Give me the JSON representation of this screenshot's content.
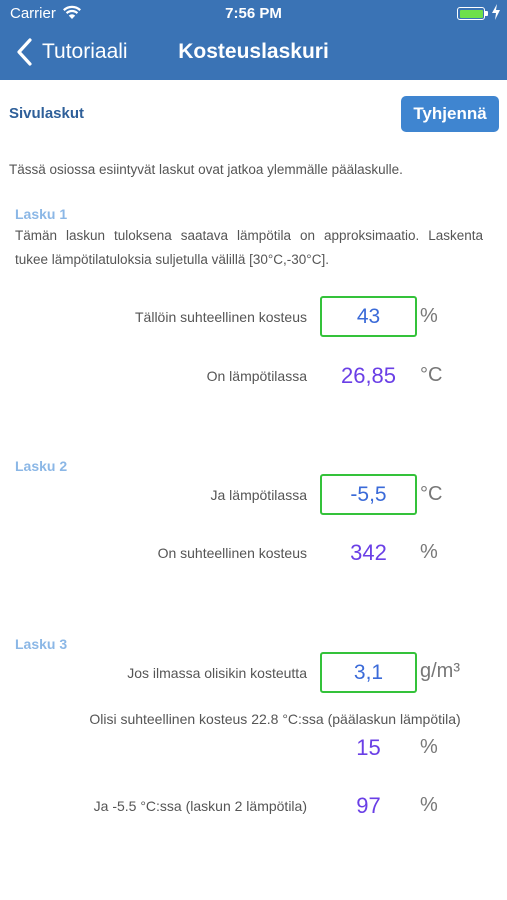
{
  "status_bar": {
    "carrier": "Carrier",
    "time": "7:56 PM"
  },
  "nav": {
    "back_label": "Tutoriaali",
    "title": "Kosteuslaskuri"
  },
  "header": {
    "section_title": "Sivulaskut",
    "clear_button": "Tyhjennä"
  },
  "intro": "Tässä osiossa esiintyvät laskut ovat jatkoa ylemmälle päälaskulle.",
  "lasku1": {
    "title": "Lasku 1",
    "description": "Tämän laskun tuloksena saatava lämpötila on approksimaatio. Laskenta tukee lämpötilatuloksia suljetulla välillä [30°C,-30°C].",
    "humidity_label": "Tällöin suhteellinen kosteus",
    "humidity_input": "43",
    "humidity_unit": "%",
    "temp_label": "On lämpötilassa",
    "temp_value": "26,85",
    "temp_unit": "°C"
  },
  "lasku2": {
    "title": "Lasku 2",
    "temp_label": "Ja lämpötilassa",
    "temp_input": "-5,5",
    "temp_unit": "°C",
    "humidity_label": "On suhteellinen kosteus",
    "humidity_value": "342",
    "humidity_unit": "%"
  },
  "lasku3": {
    "title": "Lasku 3",
    "moisture_label": "Jos ilmassa olisikin kosteutta",
    "moisture_input": "3,1",
    "moisture_unit": "g/m³",
    "rh_main_label": "Olisi suhteellinen kosteus 22.8 °C:ssa (päälaskun lämpötila)",
    "rh_main_value": "15",
    "rh_main_unit": "%",
    "rh_l2_label": "Ja -5.5 °C:ssa (laskun 2 lämpötila)",
    "rh_l2_value": "97",
    "rh_l2_unit": "%"
  },
  "colors": {
    "nav_bar": "#3a73b5",
    "button": "#3f85d0",
    "input_border": "#34c23a",
    "input_text": "#3a6ad8",
    "result_text": "#6a3fe6",
    "subheading": "#8bb7e6",
    "battery": "#6ee04a"
  },
  "icons": {
    "wifi": "wifi-icon",
    "battery": "battery-icon",
    "charging": "charging-bolt-icon",
    "back": "chevron-left-icon"
  }
}
